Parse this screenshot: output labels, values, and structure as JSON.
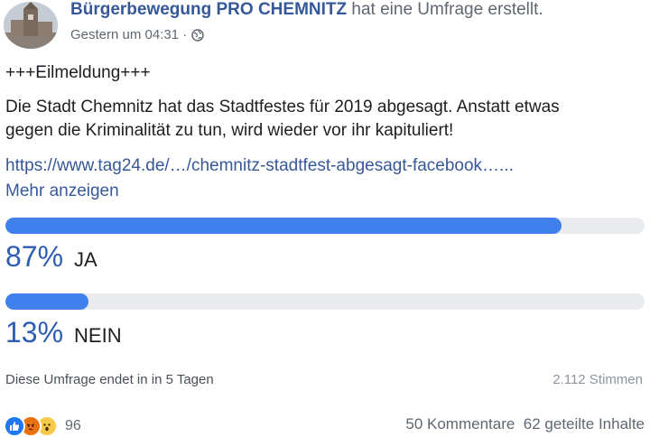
{
  "post": {
    "author": "Bürgerbewegung PRO CHEMNITZ",
    "action": "hat eine Umfrage erstellt.",
    "timestamp": "Gestern um 04:31 ·",
    "privacy_icon": "globe-icon",
    "line_headline": "+++Eilmeldung+++",
    "line_1": "Die Stadt Chemnitz hat das Stadtfestes für 2019 abgesagt. Anstatt etwas",
    "line_2": "gegen die Kriminalität zu tun, wird wieder vor ihr kapituliert!",
    "link": "https://www.tag24.de/…/chemnitz-stadtfest-abgesagt-facebook…...",
    "more": "Mehr anzeigen"
  },
  "poll": {
    "options": [
      {
        "percent_text": "87%",
        "label": "JA",
        "fraction": 0.87
      },
      {
        "percent_text": "13%",
        "label": "NEIN",
        "fraction": 0.13
      }
    ],
    "ends_text": "Diese Umfrage endet in in 5 Tagen",
    "votes_text": "2.112 Stimmen"
  },
  "footer": {
    "reactions": [
      "like-icon",
      "angry-icon",
      "wow-icon"
    ],
    "reaction_count": "96",
    "comments": "50 Kommentare",
    "shares": "62 geteilte Inhalte"
  },
  "colors": {
    "link": "#365899",
    "bar_fill": "#4080ec",
    "bar_track": "#e9ebee",
    "percent": "#2e5db4"
  }
}
